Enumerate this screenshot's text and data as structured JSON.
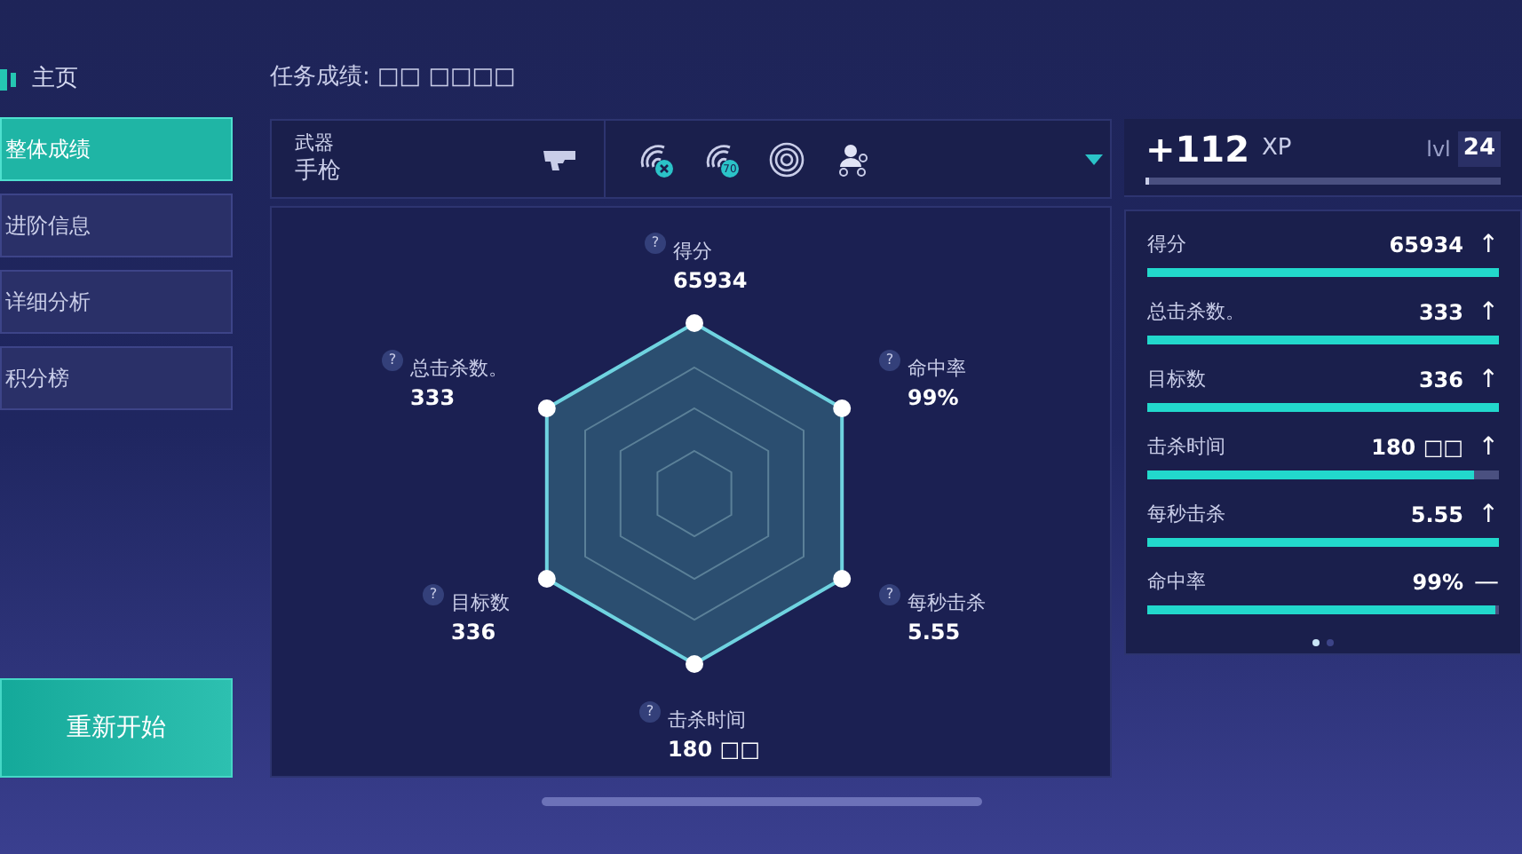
{
  "home": {
    "label": "主页"
  },
  "header": {
    "title": "任务成绩: □□ □□□□"
  },
  "sidebar": {
    "items": [
      {
        "label": "整体成绩",
        "selected": true
      },
      {
        "label": "进阶信息",
        "selected": false
      },
      {
        "label": "详细分析",
        "selected": false
      },
      {
        "label": "积分榜",
        "selected": false
      }
    ],
    "restart_button": "重新开始"
  },
  "weapon": {
    "caption": "武器",
    "name": "手枪"
  },
  "mode_icons": [
    {
      "kind": "radar-x"
    },
    {
      "kind": "radar",
      "badge": "70"
    },
    {
      "kind": "target"
    },
    {
      "kind": "person"
    }
  ],
  "radar": {
    "axes": [
      {
        "label": "得分",
        "value": "65934"
      },
      {
        "label": "总击杀数。",
        "value": "333"
      },
      {
        "label": "命中率",
        "value": "99%"
      },
      {
        "label": "目标数",
        "value": "336"
      },
      {
        "label": "每秒击杀",
        "value": "5.55"
      },
      {
        "label": "击杀时间",
        "value": "180 □□"
      }
    ],
    "help_mark": "?"
  },
  "xp": {
    "gain": "+112",
    "unit": "XP",
    "level_label": "lvl",
    "level_value": "24",
    "level": 0.01
  },
  "stats": [
    {
      "label": "得分",
      "value": "65934",
      "trend": "↑",
      "level": 1
    },
    {
      "label": "总击杀数。",
      "value": "333",
      "trend": "↑",
      "level": 1
    },
    {
      "label": "目标数",
      "value": "336",
      "trend": "↑",
      "level": 1
    },
    {
      "label": "击杀时间",
      "value": "180 □□",
      "trend": "↑",
      "level": 0.93
    },
    {
      "label": "每秒击杀",
      "value": "5.55",
      "trend": "↑",
      "level": 1
    },
    {
      "label": "命中率",
      "value": "99%",
      "trend": "—",
      "level": 0.99
    }
  ],
  "pages": [
    {
      "selected": true
    },
    {
      "selected": false
    }
  ]
}
